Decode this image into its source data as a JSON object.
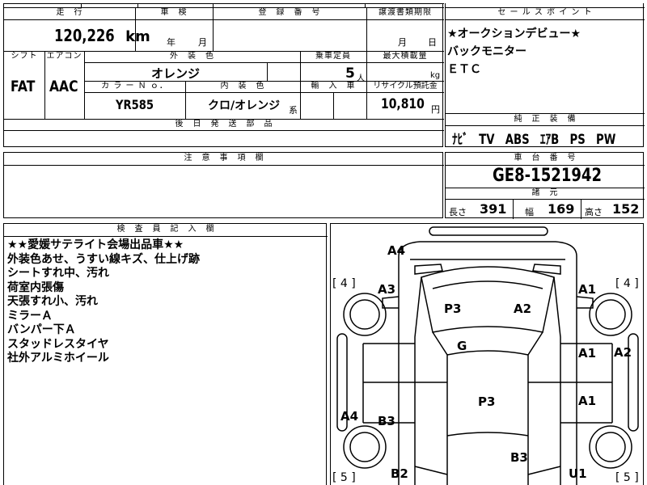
{
  "header": {
    "mileage_label": "走　行",
    "inspection_label": "車　検",
    "registration_label": "登　録　番　号",
    "transfer_label": "譲渡書類期限",
    "mileage_value": "120,226",
    "mileage_unit": "km",
    "inspection_year": "年",
    "inspection_month": "月",
    "transfer_month": "月",
    "transfer_day": "日"
  },
  "spec": {
    "shift_label": "シフト",
    "ac_label": "エアコン",
    "exterior_label": "外　装　色",
    "capacity_label": "乗車定員",
    "max_load_label": "最大積載量",
    "shift_value": "FAT",
    "ac_value": "AAC",
    "exterior_value": "オレンジ",
    "capacity_value": "5",
    "capacity_unit": "人",
    "max_load_unit": "kg",
    "color_no_label": "カ ラ ー Ｎ ｏ．",
    "interior_label": "内　装　色",
    "import_label": "輸　入　車",
    "recycle_label": "リサイクル預託金",
    "color_no_value": "YR585",
    "interior_value": "クロ/オレンジ",
    "interior_suffix": "系",
    "recycle_value": "10,810",
    "recycle_unit": "円",
    "later_parts_label": "後　日　発　送　部　品"
  },
  "sales_points": {
    "label": "セ ー ル ス ポ イ ン ト",
    "lines": [
      "★オークションデビュー★",
      "バックモニター",
      "ＥＴＣ"
    ]
  },
  "equipment": {
    "label": "純　正　装　備",
    "value": "ﾅﾋﾞ　TV　ABS　ｴｱB　PS　PW"
  },
  "notes": {
    "label": "注　意　事　項　欄"
  },
  "chassis": {
    "label": "車　台　番　号",
    "value": "GE8-1521942"
  },
  "dimensions": {
    "label": "諸　元",
    "length_label": "長さ",
    "length_value": "391",
    "width_label": "幅",
    "width_value": "169",
    "height_label": "高さ",
    "height_value": "152"
  },
  "inspector": {
    "label": "検　査　員　記　入　欄",
    "lines": [
      "★★愛媛サテライト会場出品車★★",
      "外装色あせ、うすい線キズ、仕上げ跡",
      "シートすれ中、汚れ",
      "荷室内張傷",
      "天張すれ小、汚れ",
      "ミラーＡ",
      "バンパー下Ａ",
      "スタッドレスタイヤ",
      "社外アルミホイール"
    ]
  },
  "diagram": {
    "tl_bracket": "[ 4 ]",
    "tr_bracket": "[ 4 ]",
    "bl_bracket": "[ 5 ]",
    "br_bracket": "[ 5 ]",
    "marks": {
      "a4_top": "A4",
      "a3": "A3",
      "a1_tr": "A1",
      "p3_top": "P3",
      "a2_top": "A2",
      "g": "G",
      "a1_mid": "A1",
      "a2_right": "A2",
      "p3_mid": "P3",
      "a1_lower": "A1",
      "a4_left": "A4",
      "b3_left": "B3",
      "b3_bottom": "B3",
      "b2": "B2",
      "u1": "U1"
    }
  }
}
